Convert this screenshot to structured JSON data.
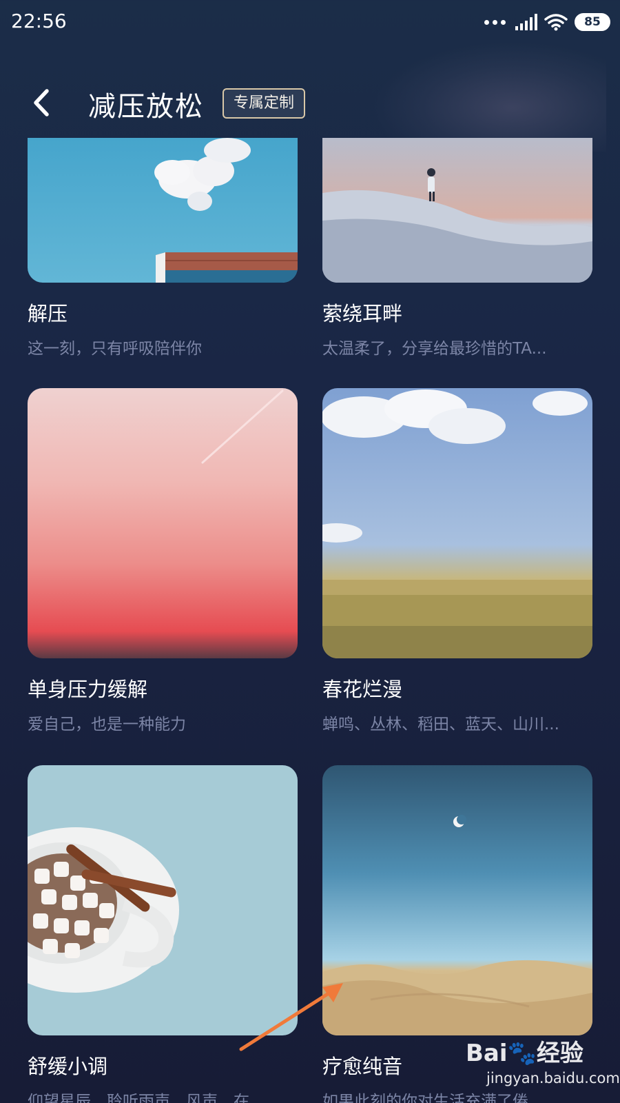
{
  "status_bar": {
    "time": "22:56",
    "battery": "85",
    "icons": [
      "more-dots-icon",
      "signal-icon",
      "wifi-icon",
      "battery-icon"
    ]
  },
  "header": {
    "back_icon": "chevron-left-icon",
    "title": "减压放松",
    "tag_button": "专属定制"
  },
  "cards": [
    {
      "title": "解压",
      "subtitle": "这一刻，只有呼吸陪伴你",
      "image": "blue-sky-cloud-roof"
    },
    {
      "title": "萦绕耳畔",
      "subtitle": "太温柔了，分享给最珍惜的TA...",
      "image": "person-on-snow-hill"
    },
    {
      "title": "单身压力缓解",
      "subtitle": "爱自己，也是一种能力",
      "image": "pink-gradient-sky"
    },
    {
      "title": "春花烂漫",
      "subtitle": "蝉鸣、丛林、稻田、蓝天、山川...",
      "image": "wheat-field-blue-sky"
    },
    {
      "title": "舒缓小调",
      "subtitle": "仰望星辰，聆听雨声，风声，在...",
      "image": "cocoa-marshmallow-cup"
    },
    {
      "title": "疗愈纯音",
      "subtitle": "如果此刻的你对生活充满了倦...",
      "image": "desert-dunes-moon"
    }
  ],
  "watermark": {
    "brand": "Bai🐾经验",
    "url": "jingyan.baidu.com"
  },
  "colors": {
    "background_top": "#1b2d48",
    "background_bottom": "#171c36",
    "subtitle": "#7c85a6",
    "tag_border": "#d9c8a8",
    "annotation_arrow": "#f07a3a"
  }
}
